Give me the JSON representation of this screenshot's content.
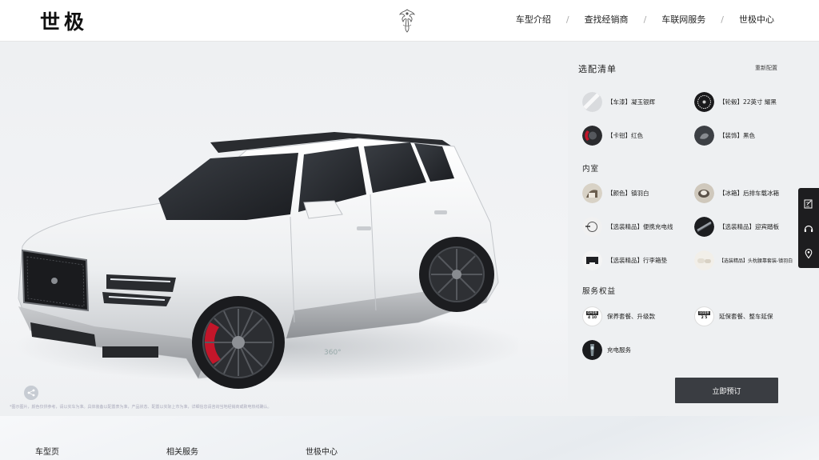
{
  "header": {
    "logo": "世极",
    "nav": [
      "车型介绍",
      "查找经销商",
      "车联网服务",
      "世极中心"
    ],
    "separator": "/"
  },
  "stage": {
    "rotate_label": "360°",
    "disclaimer": "*图示图片，颜色仅供参考，请以实车为准。具体装备以配置表为准，产品状态、配置以实际上市为准，详细信息请咨询当地经销商或致电热线确认。"
  },
  "config": {
    "title": "选配清单",
    "reset": "重新配置",
    "exterior": [
      {
        "label": "【车漆】凝玉银辉",
        "icon": "paint-swatch-icon"
      },
      {
        "label": "【轮毂】22英寸 耀黑",
        "icon": "wheel-icon"
      },
      {
        "label": "【卡钳】红色",
        "icon": "caliper-icon"
      },
      {
        "label": "【装饰】黑色",
        "icon": "trim-icon"
      }
    ],
    "interior_title": "内室",
    "interior": [
      {
        "label": "【颜色】镇羽白",
        "icon": "interior-color-icon"
      },
      {
        "label": "【冰箱】后排车载冰箱",
        "icon": "fridge-icon"
      },
      {
        "label": "【选装精品】便携充电线",
        "icon": "charging-cable-icon"
      },
      {
        "label": "【选装精品】迎宾踏板",
        "icon": "welcome-pedal-icon"
      },
      {
        "label": "【选装精品】行李箱垫",
        "icon": "trunk-mat-icon"
      },
      {
        "label": "【选装精品】头枕腰靠套装-镇羽白",
        "icon": "headrest-icon"
      }
    ],
    "services_title": "服务权益",
    "services": [
      {
        "label": "保养套餐、升级款",
        "icon": "maintenance-icon",
        "badge_top": "保养套餐",
        "badge_bottom": "4 10"
      },
      {
        "label": "延保套餐、整车延保",
        "icon": "warranty-icon",
        "badge_top": "延保套餐",
        "badge_bottom": "2 5"
      },
      {
        "label": "充电服务",
        "icon": "charging-service-icon"
      }
    ],
    "order_button": "立即预订"
  },
  "footer": {
    "links": [
      "车型页",
      "相关服务",
      "世极中心"
    ]
  },
  "colors": {
    "accent_dark": "#3a3d42",
    "caliper_red": "#c3162a",
    "background": "#eef0f2"
  }
}
